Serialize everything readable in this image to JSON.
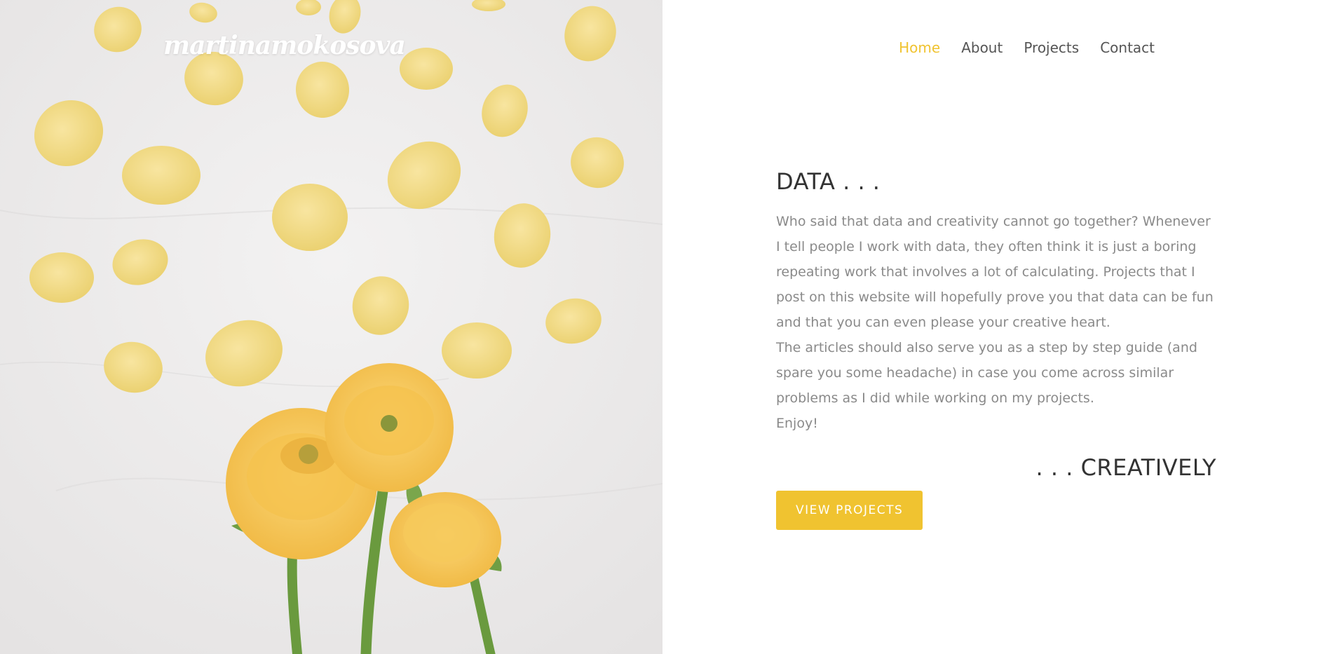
{
  "site": {
    "logo_text": "martinamokosova"
  },
  "nav": {
    "items": [
      {
        "label": "Home",
        "active": true
      },
      {
        "label": "About",
        "active": false
      },
      {
        "label": "Projects",
        "active": false
      },
      {
        "label": "Contact",
        "active": false
      }
    ]
  },
  "hero": {
    "heading_start": "DATA . . .",
    "paragraphs": [
      "Who said that data and creativity cannot go together? Whenever I tell people I work with data, they often think it is just a boring repeating work that involves a lot of calculating. Projects that I post on this website will hopefully prove you that data can be fun and that you can even please your creative heart.",
      "The articles should also serve you as a step by step guide (and spare you some headache) in case you come across similar problems as I did while working on my projects.",
      "Enjoy!"
    ],
    "heading_end": ". . . CREATIVELY",
    "cta_label": "VIEW PROJECTS"
  },
  "colors": {
    "accent": "#f0c330",
    "heading": "#333333",
    "body_text": "#8a8a8a",
    "nav_text": "#555555",
    "petal": "#f4dc86",
    "flower": "#f7c654",
    "stem": "#6a9a3e"
  },
  "icons": {
    "hero_image": "yellow-flowers-and-petals-photo"
  }
}
